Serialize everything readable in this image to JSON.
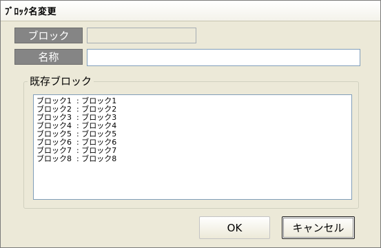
{
  "window": {
    "title": "ﾌﾞﾛｯｸ名変更"
  },
  "form": {
    "block_label": "ブロック",
    "block_value": "",
    "name_label": "名称",
    "name_value": ""
  },
  "existing": {
    "legend": "既存ブロック",
    "items": [
      "ブロック1  : ブロック1",
      "ブロック2  : ブロック2",
      "ブロック3  : ブロック3",
      "ブロック4  : ブロック4",
      "ブロック5  : ブロック5",
      "ブロック6  : ブロック6",
      "ブロック7  : ブロック7",
      "ブロック8  : ブロック8"
    ]
  },
  "buttons": {
    "ok": "OK",
    "cancel": "キャンセル"
  }
}
